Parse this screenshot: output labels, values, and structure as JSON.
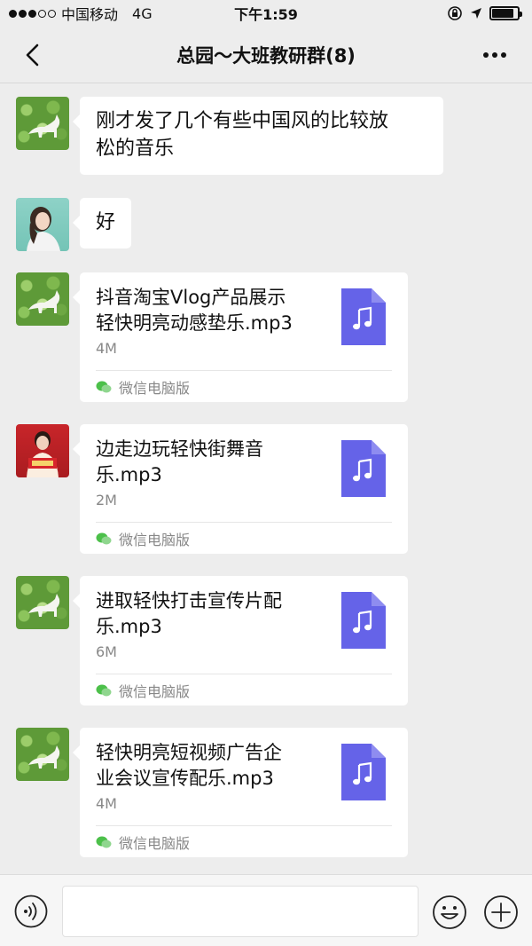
{
  "status_bar": {
    "carrier": "中国移动",
    "network": "4G",
    "time": "下午1:59",
    "battery_level": 0.85
  },
  "header": {
    "title": "总园～大班教研群(8)"
  },
  "messages": [
    {
      "type": "text",
      "avatar": "cat-photo",
      "text_line1": "刚才发了几个有些中国风的比较放",
      "text_line2": "松的音乐"
    },
    {
      "type": "text",
      "avatar": "girl-photo",
      "text_line1": "好"
    },
    {
      "type": "file",
      "avatar": "cat-photo",
      "name_line1": "抖音淘宝Vlog产品展示",
      "name_line2": "轻快明亮动感垫乐.mp3",
      "size": "4M",
      "source": "微信电脑版"
    },
    {
      "type": "file",
      "avatar": "person-red-photo",
      "name_line1": "边走边玩轻快街舞音",
      "name_line2": "乐.mp3",
      "size": "2M",
      "source": "微信电脑版"
    },
    {
      "type": "file",
      "avatar": "cat-photo",
      "name_line1": "进取轻快打击宣传片配",
      "name_line2": "乐.mp3",
      "size": "6M",
      "source": "微信电脑版"
    },
    {
      "type": "file",
      "avatar": "cat-photo",
      "name_line1": "轻快明亮短视频广告企",
      "name_line2": "业会议宣传配乐.mp3",
      "size": "4M",
      "source": "微信电脑版"
    }
  ],
  "colors": {
    "file_icon": "#6563e8",
    "background": "#ededed",
    "bubble": "#ffffff",
    "wechat_green": "#4cc04a"
  },
  "icons": [
    "back-chevron-icon",
    "more-dots-icon",
    "music-file-icon",
    "wechat-icon",
    "voice-icon",
    "emoji-icon",
    "plus-icon",
    "lock-rotation-icon",
    "location-arrow-icon",
    "battery-icon"
  ],
  "input": {
    "value": "",
    "placeholder": ""
  }
}
